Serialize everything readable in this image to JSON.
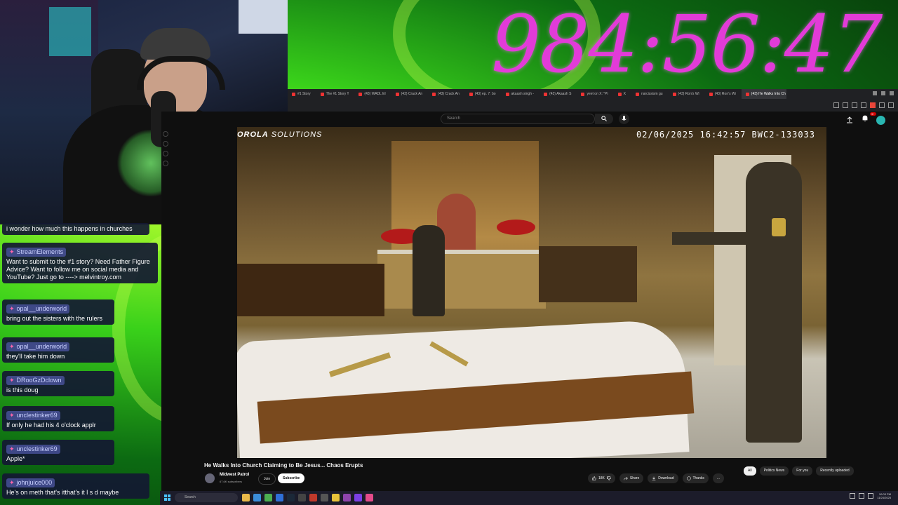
{
  "timer": "984:56:47",
  "browser": {
    "tabs": [
      {
        "label": "#1 Story",
        "active": false
      },
      {
        "label": "The #1 Story !!",
        "active": false
      },
      {
        "label": "(43) WADL El",
        "active": false
      },
      {
        "label": "(43) Crack An",
        "active": false
      },
      {
        "label": "(43) Crack An",
        "active": false
      },
      {
        "label": "(43) ep. 7: bo",
        "active": false
      },
      {
        "label": "akaash singh -",
        "active": false
      },
      {
        "label": "(43) Akaash S",
        "active": false
      },
      {
        "label": "yeet on X: \"Pi",
        "active": false
      },
      {
        "label": "X",
        "active": false
      },
      {
        "label": "narcissism gu",
        "active": false
      },
      {
        "label": "(43) Ron's Wi",
        "active": false
      },
      {
        "label": "(43) Ron's Wi",
        "active": false
      },
      {
        "label": "(43) He Walks Into Ch",
        "active": true
      }
    ]
  },
  "youtube": {
    "search_placeholder": "Search",
    "notification_count": "9+",
    "video": {
      "brand_bold": "OROLA",
      "brand_light": " SOLUTIONS",
      "timestamp": "02/06/2025  16:42:57   BWC2-133033"
    },
    "title": "He Walks Into Church Claiming to Be Jesus... Chaos Erupts",
    "channel": {
      "name": "Midwest Patrol",
      "subs": "67.6K subscribers"
    },
    "join_label": "Join",
    "subscribe_label": "Subscribe",
    "actions": {
      "likes": "18K",
      "share": "Share",
      "download": "Download",
      "thanks": "Thanks",
      "more": "..."
    },
    "chips": [
      "All",
      "Politics News",
      "For you",
      "Recently uploaded"
    ]
  },
  "chat": {
    "messages": [
      {
        "user": "",
        "text": "i wonder how much this happens in churches"
      },
      {
        "user": "StreamElements",
        "text": "Want to submit to the #1 story? Need Father Figure Advice? Want to follow me on social media and YouTube? Just go to ----> melvintroy.com"
      },
      {
        "user": "opal__underworld",
        "text": "bring out the sisters with the rulers"
      },
      {
        "user": "opal__underworld",
        "text": "they'll take him down"
      },
      {
        "user": "DRooGzDclown",
        "text": "is this doug"
      },
      {
        "user": "unclestinker69",
        "text": "If only he had his 4 o'clock applr"
      },
      {
        "user": "unclestinker69",
        "text": "Apple*"
      },
      {
        "user": "johnjuice000",
        "text": "He's on meth that's itthat's it l s d maybe"
      }
    ]
  },
  "taskbar": {
    "search_placeholder": "Search",
    "time": "10:03 PM",
    "date": "11/24/2025"
  },
  "colors": {
    "timer": "#e23bd8",
    "yt_bg": "#0f0f0f",
    "chat_bg": "#141832",
    "subscribe_bg": "#ffffff"
  }
}
